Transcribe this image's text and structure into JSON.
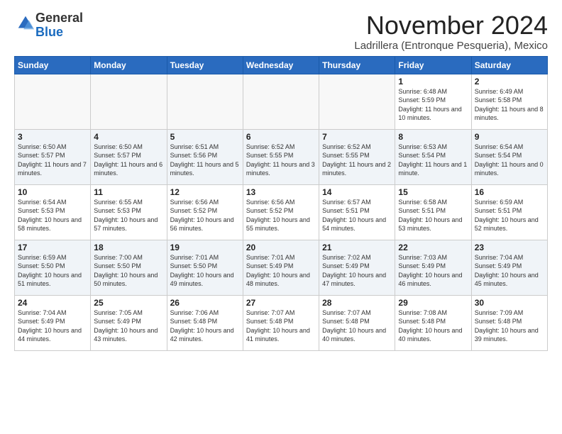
{
  "logo": {
    "general": "General",
    "blue": "Blue"
  },
  "header": {
    "month": "November 2024",
    "location": "Ladrillera (Entronque Pesqueria), Mexico"
  },
  "weekdays": [
    "Sunday",
    "Monday",
    "Tuesday",
    "Wednesday",
    "Thursday",
    "Friday",
    "Saturday"
  ],
  "weeks": [
    [
      {
        "day": "",
        "info": ""
      },
      {
        "day": "",
        "info": ""
      },
      {
        "day": "",
        "info": ""
      },
      {
        "day": "",
        "info": ""
      },
      {
        "day": "",
        "info": ""
      },
      {
        "day": "1",
        "info": "Sunrise: 6:48 AM\nSunset: 5:59 PM\nDaylight: 11 hours and 10 minutes."
      },
      {
        "day": "2",
        "info": "Sunrise: 6:49 AM\nSunset: 5:58 PM\nDaylight: 11 hours and 8 minutes."
      }
    ],
    [
      {
        "day": "3",
        "info": "Sunrise: 6:50 AM\nSunset: 5:57 PM\nDaylight: 11 hours and 7 minutes."
      },
      {
        "day": "4",
        "info": "Sunrise: 6:50 AM\nSunset: 5:57 PM\nDaylight: 11 hours and 6 minutes."
      },
      {
        "day": "5",
        "info": "Sunrise: 6:51 AM\nSunset: 5:56 PM\nDaylight: 11 hours and 5 minutes."
      },
      {
        "day": "6",
        "info": "Sunrise: 6:52 AM\nSunset: 5:55 PM\nDaylight: 11 hours and 3 minutes."
      },
      {
        "day": "7",
        "info": "Sunrise: 6:52 AM\nSunset: 5:55 PM\nDaylight: 11 hours and 2 minutes."
      },
      {
        "day": "8",
        "info": "Sunrise: 6:53 AM\nSunset: 5:54 PM\nDaylight: 11 hours and 1 minute."
      },
      {
        "day": "9",
        "info": "Sunrise: 6:54 AM\nSunset: 5:54 PM\nDaylight: 11 hours and 0 minutes."
      }
    ],
    [
      {
        "day": "10",
        "info": "Sunrise: 6:54 AM\nSunset: 5:53 PM\nDaylight: 10 hours and 58 minutes."
      },
      {
        "day": "11",
        "info": "Sunrise: 6:55 AM\nSunset: 5:53 PM\nDaylight: 10 hours and 57 minutes."
      },
      {
        "day": "12",
        "info": "Sunrise: 6:56 AM\nSunset: 5:52 PM\nDaylight: 10 hours and 56 minutes."
      },
      {
        "day": "13",
        "info": "Sunrise: 6:56 AM\nSunset: 5:52 PM\nDaylight: 10 hours and 55 minutes."
      },
      {
        "day": "14",
        "info": "Sunrise: 6:57 AM\nSunset: 5:51 PM\nDaylight: 10 hours and 54 minutes."
      },
      {
        "day": "15",
        "info": "Sunrise: 6:58 AM\nSunset: 5:51 PM\nDaylight: 10 hours and 53 minutes."
      },
      {
        "day": "16",
        "info": "Sunrise: 6:59 AM\nSunset: 5:51 PM\nDaylight: 10 hours and 52 minutes."
      }
    ],
    [
      {
        "day": "17",
        "info": "Sunrise: 6:59 AM\nSunset: 5:50 PM\nDaylight: 10 hours and 51 minutes."
      },
      {
        "day": "18",
        "info": "Sunrise: 7:00 AM\nSunset: 5:50 PM\nDaylight: 10 hours and 50 minutes."
      },
      {
        "day": "19",
        "info": "Sunrise: 7:01 AM\nSunset: 5:50 PM\nDaylight: 10 hours and 49 minutes."
      },
      {
        "day": "20",
        "info": "Sunrise: 7:01 AM\nSunset: 5:49 PM\nDaylight: 10 hours and 48 minutes."
      },
      {
        "day": "21",
        "info": "Sunrise: 7:02 AM\nSunset: 5:49 PM\nDaylight: 10 hours and 47 minutes."
      },
      {
        "day": "22",
        "info": "Sunrise: 7:03 AM\nSunset: 5:49 PM\nDaylight: 10 hours and 46 minutes."
      },
      {
        "day": "23",
        "info": "Sunrise: 7:04 AM\nSunset: 5:49 PM\nDaylight: 10 hours and 45 minutes."
      }
    ],
    [
      {
        "day": "24",
        "info": "Sunrise: 7:04 AM\nSunset: 5:49 PM\nDaylight: 10 hours and 44 minutes."
      },
      {
        "day": "25",
        "info": "Sunrise: 7:05 AM\nSunset: 5:49 PM\nDaylight: 10 hours and 43 minutes."
      },
      {
        "day": "26",
        "info": "Sunrise: 7:06 AM\nSunset: 5:48 PM\nDaylight: 10 hours and 42 minutes."
      },
      {
        "day": "27",
        "info": "Sunrise: 7:07 AM\nSunset: 5:48 PM\nDaylight: 10 hours and 41 minutes."
      },
      {
        "day": "28",
        "info": "Sunrise: 7:07 AM\nSunset: 5:48 PM\nDaylight: 10 hours and 40 minutes."
      },
      {
        "day": "29",
        "info": "Sunrise: 7:08 AM\nSunset: 5:48 PM\nDaylight: 10 hours and 40 minutes."
      },
      {
        "day": "30",
        "info": "Sunrise: 7:09 AM\nSunset: 5:48 PM\nDaylight: 10 hours and 39 minutes."
      }
    ]
  ]
}
